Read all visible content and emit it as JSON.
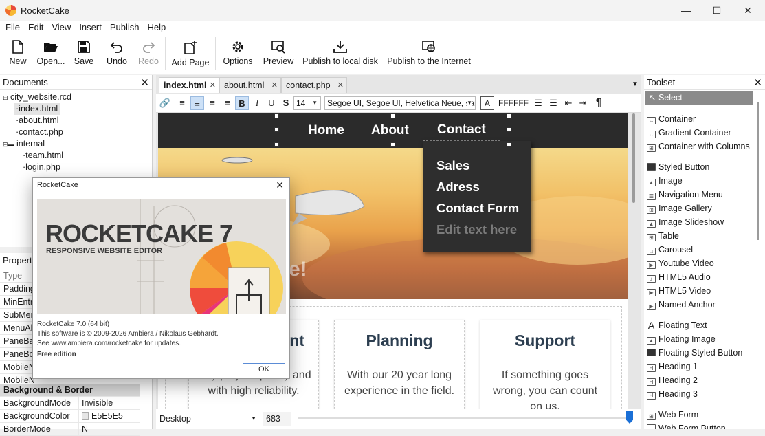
{
  "app": {
    "title": "RocketCake"
  },
  "window": {
    "minimize": "—",
    "maximize": "☐",
    "close": "✕"
  },
  "menu": [
    "File",
    "Edit",
    "View",
    "Insert",
    "Publish",
    "Help"
  ],
  "toolbar": {
    "new": "New",
    "open": "Open...",
    "save": "Save",
    "undo": "Undo",
    "redo": "Redo",
    "add_page": "Add Page",
    "options": "Options",
    "preview": "Preview",
    "publish_local": "Publish to local disk",
    "publish_internet": "Publish to the Internet"
  },
  "documents": {
    "title": "Documents",
    "project": "city_website.rcd",
    "files": [
      "index.html",
      "about.html",
      "contact.php"
    ],
    "folder": "internal",
    "folder_files": [
      "team.html",
      "login.php"
    ]
  },
  "properties": {
    "title": "Properti",
    "rows": [
      {
        "name": "Type",
        "value": ""
      },
      {
        "name": "Padding",
        "value": ""
      },
      {
        "name": "MinEntr",
        "value": ""
      },
      {
        "name": "SubMen",
        "value": ""
      },
      {
        "name": "MenuAl",
        "value": ""
      },
      {
        "name": "PaneBac",
        "value": ""
      },
      {
        "name": "PaneBor",
        "value": ""
      },
      {
        "name": "MobileN",
        "value": ""
      },
      {
        "name": "MobileN",
        "value": ""
      }
    ],
    "section": "Background & Border",
    "bg_rows": [
      {
        "name": "BackgroundMode",
        "value": "Invisible"
      },
      {
        "name": "BackgroundColor",
        "value": "E5E5E5"
      },
      {
        "name": "BorderMode",
        "value": "N"
      }
    ]
  },
  "tabs": [
    {
      "label": "index.html",
      "active": true
    },
    {
      "label": "about.html",
      "active": false
    },
    {
      "label": "contact.php",
      "active": false
    }
  ],
  "format": {
    "font_size": "14",
    "font_family": "Segoe UI, Segoe UI, Helvetica Neue, san",
    "color_label": "A",
    "color_value": "FFFFFF"
  },
  "site": {
    "nav": [
      "Home",
      "About",
      "Contact"
    ],
    "dropdown": [
      "Sales",
      "Adress",
      "Contact Form",
      "Edit text here"
    ],
    "cards": [
      {
        "title": "nt",
        "text": "...ny project quickly and with high reliability."
      },
      {
        "title": "Planning",
        "text": "With our 20 year long experience in the field."
      },
      {
        "title": "Support",
        "text": "If something goes wrong, you can count on us."
      }
    ],
    "hero_partial": "e!"
  },
  "bottom": {
    "view": "Desktop",
    "width": "683"
  },
  "toolset": {
    "title": "Toolset",
    "select": "Select",
    "items": [
      "Container",
      "Gradient Container",
      "Container with Columns",
      "Styled Button",
      "Image",
      "Navigation Menu",
      "Image Gallery",
      "Image Slideshow",
      "Table",
      "Carousel",
      "Youtube Video",
      "HTML5 Audio",
      "HTML5 Video",
      "Named Anchor",
      "Floating Text",
      "Floating Image",
      "Floating Styled Button",
      "Heading 1",
      "Heading 2",
      "Heading 3",
      "Web Form",
      "Web Form Button"
    ]
  },
  "dialog": {
    "title": "RocketCake",
    "logo_text": "ROCKETCAKE 7",
    "logo_sub": "RESPONSIVE WEBSITE EDITOR",
    "version": "RocketCake 7.0 (64 bit)",
    "copyright": "This software is © 2009-2026 Ambiera / Nikolaus Gebhardt.",
    "updates": "See www.ambiera.com/rocketcake for updates.",
    "edition": "Free edition",
    "ok": "OK"
  }
}
